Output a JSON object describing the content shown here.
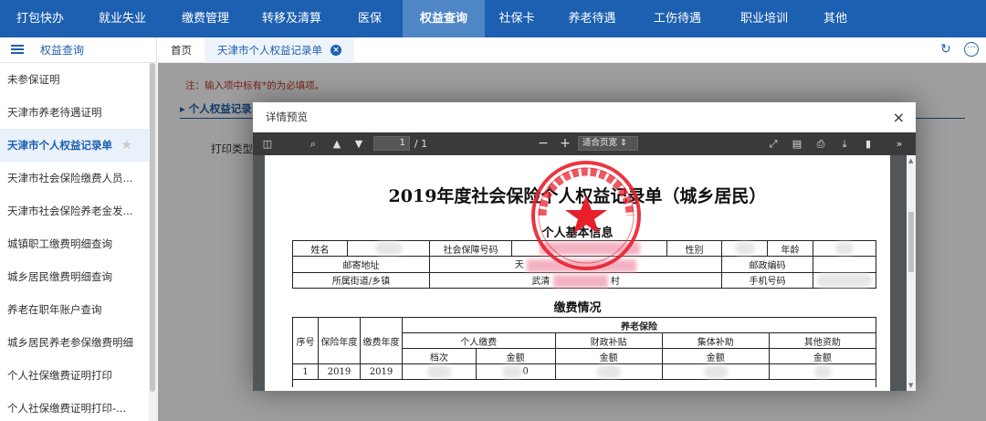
{
  "topnav": {
    "items": [
      "打包快办",
      "就业失业",
      "缴费管理",
      "转移及清算",
      "医保",
      "权益查询",
      "社保卡",
      "养老待遇",
      "工伤待遇",
      "职业培训",
      "其他"
    ],
    "active": "权益查询"
  },
  "sidebar": {
    "header": "权益查询",
    "items": [
      "未参保证明",
      "天津市养老待遇证明",
      "天津市个人权益记录单",
      "天津市社会保险缴费人员...",
      "天津市社会保险养老金发...",
      "城镇职工缴费明细查询",
      "城乡居民缴费明细查询",
      "养老在职年账户查询",
      "城乡居民养老参保缴费明细",
      "个人社保缴费证明打印",
      "个人社保缴费证明打印-..."
    ],
    "active_item": "天津市个人权益记录单"
  },
  "tabs": {
    "home": "首页",
    "current": "天津市个人权益记录单"
  },
  "page": {
    "required_note": "注：输入项中标有*的为必填项。",
    "section_title": "个人权益记录",
    "print_type_label": "打印类型"
  },
  "modal": {
    "title": "详情预览",
    "close_label": "×"
  },
  "pdf_toolbar": {
    "page_current": "1",
    "page_total": "/ 1",
    "zoom_option": "适合页宽"
  },
  "document": {
    "title": "2019年度社会保险个人权益记录单（城乡居民）",
    "basic_info_heading": "个人基本信息",
    "basic_info": {
      "name_label": "姓名",
      "ssn_label": "社会保障号码",
      "gender_label": "性别",
      "age_label": "年龄",
      "mail_address_label": "邮寄地址",
      "mail_address_prefix": "天",
      "postcode_label": "邮政编码",
      "street_label": "所属街道/乡镇",
      "street_value": "武清",
      "street_suffix": "村",
      "phone_label": "手机号码"
    },
    "payment_heading": "缴费情况",
    "payment_table": {
      "col_seq": "序号",
      "col_insurance_year": "保险年度",
      "col_payment_year": "缴费年度",
      "group_pension": "养老保险",
      "sub_personal": "个人缴费",
      "sub_subsidy": "财政补贴",
      "sub_collective": "集体补助",
      "sub_other": "其他资助",
      "grade_label": "档次",
      "amount_label": "金额",
      "rows": [
        {
          "seq": "1",
          "insurance_year": "2019",
          "payment_year": "2019",
          "amount_tail": "0"
        }
      ]
    }
  },
  "colors": {
    "nav_blue": "#1d5fb0",
    "nav_active": "#4f86c6",
    "stamp_red": "#e8202c"
  }
}
